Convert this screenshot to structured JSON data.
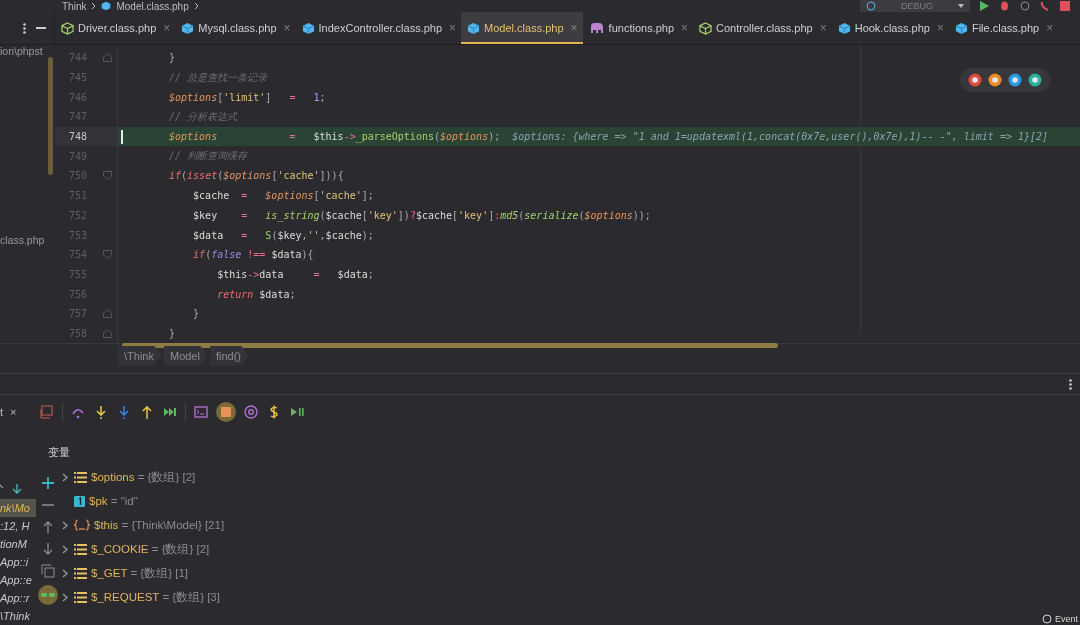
{
  "top_breadcrumbs": [
    "Think",
    "Model.class.php"
  ],
  "run_config": {
    "label": "DEBUG"
  },
  "tabs": [
    {
      "label": "Driver.class.php",
      "kind": "outline",
      "close": "×",
      "selected": false
    },
    {
      "label": "Mysql.class.php",
      "kind": "solid",
      "close": "×",
      "selected": false
    },
    {
      "label": "IndexController.class.php",
      "kind": "solid",
      "close": "×",
      "selected": false
    },
    {
      "label": "Model.class.php",
      "kind": "solid",
      "close": "×",
      "selected": true
    },
    {
      "label": "functions.php",
      "kind": "elephant",
      "close": "×",
      "selected": false
    },
    {
      "label": "Controller.class.php",
      "kind": "outline",
      "close": "×",
      "selected": false
    },
    {
      "label": "Hook.class.php",
      "kind": "solid",
      "close": "×",
      "selected": false
    },
    {
      "label": "File.class.php",
      "kind": "solid",
      "close": "×",
      "selected": false
    }
  ],
  "project_panel": {
    "items": [
      "ion\\phpst",
      "class.php"
    ]
  },
  "editor": {
    "lines": [
      {
        "number": "744",
        "current": false,
        "fold_end": true,
        "tokens": [
          {
            "kind": "punct",
            "text": "}"
          }
        ]
      },
      {
        "number": "745",
        "current": false,
        "tokens": [
          {
            "kind": "comment",
            "text": "// 总是查找一条记录"
          }
        ]
      },
      {
        "number": "746",
        "current": false,
        "tokens": [
          {
            "kind": "param",
            "text": "$options"
          },
          {
            "kind": "punct",
            "text": "["
          },
          {
            "kind": "str",
            "text": "'limit'"
          },
          {
            "kind": "punct",
            "text": "]"
          },
          {
            "kind": "op",
            "text": "   ="
          },
          {
            "kind": "num",
            "text": "   1"
          },
          {
            "kind": "punct",
            "text": ";"
          }
        ]
      },
      {
        "number": "747",
        "current": false,
        "tokens": [
          {
            "kind": "comment",
            "text": "// 分析表达式"
          }
        ]
      },
      {
        "number": "748",
        "current": true,
        "tokens": [
          {
            "kind": "param",
            "text": "$options"
          },
          {
            "kind": "op",
            "text": "            ="
          },
          {
            "kind": "var",
            "text": "   $this"
          },
          {
            "kind": "op",
            "text": "->"
          },
          {
            "kind": "method",
            "text": "_parseOptions"
          },
          {
            "kind": "punct",
            "text": "("
          },
          {
            "kind": "param",
            "text": "$options"
          },
          {
            "kind": "punct",
            "text": ");"
          },
          {
            "kind": "hint",
            "text": "  $options: {where => \"1 and 1=updatexml(1,concat(0x7e,user(),0x7e),1)-- -\", limit => 1}[2]"
          }
        ]
      },
      {
        "number": "749",
        "current": false,
        "tokens": [
          {
            "kind": "comment",
            "text": "// 判断查询缓存"
          }
        ]
      },
      {
        "number": "750",
        "current": false,
        "fold_start": true,
        "tokens": [
          {
            "kind": "kw",
            "text": "if"
          },
          {
            "kind": "punct",
            "text": "("
          },
          {
            "kind": "kw",
            "text": "isset"
          },
          {
            "kind": "punct",
            "text": "("
          },
          {
            "kind": "param",
            "text": "$options"
          },
          {
            "kind": "punct",
            "text": "["
          },
          {
            "kind": "str",
            "text": "'cache'"
          },
          {
            "kind": "punct",
            "text": "])){"
          }
        ]
      },
      {
        "number": "751",
        "current": false,
        "tokens": [
          {
            "kind": "var",
            "text": "    $cache"
          },
          {
            "kind": "op",
            "text": "  ="
          },
          {
            "kind": "param",
            "text": "   $options"
          },
          {
            "kind": "punct",
            "text": "["
          },
          {
            "kind": "str",
            "text": "'cache'"
          },
          {
            "kind": "punct",
            "text": "];"
          }
        ]
      },
      {
        "number": "752",
        "current": false,
        "tokens": [
          {
            "kind": "var",
            "text": "    $key"
          },
          {
            "kind": "op",
            "text": "    ="
          },
          {
            "kind": "fn",
            "text": "   is_string"
          },
          {
            "kind": "punct",
            "text": "("
          },
          {
            "kind": "var",
            "text": "$cache"
          },
          {
            "kind": "punct",
            "text": "["
          },
          {
            "kind": "str",
            "text": "'key'"
          },
          {
            "kind": "punct",
            "text": "])"
          },
          {
            "kind": "op",
            "text": "?"
          },
          {
            "kind": "var",
            "text": "$cache"
          },
          {
            "kind": "punct",
            "text": "["
          },
          {
            "kind": "str",
            "text": "'key'"
          },
          {
            "kind": "punct",
            "text": "]"
          },
          {
            "kind": "op",
            "text": ":"
          },
          {
            "kind": "fn",
            "text": "md5"
          },
          {
            "kind": "punct",
            "text": "("
          },
          {
            "kind": "fn",
            "text": "serialize"
          },
          {
            "kind": "punct",
            "text": "("
          },
          {
            "kind": "param",
            "text": "$options"
          },
          {
            "kind": "punct",
            "text": "));"
          }
        ]
      },
      {
        "number": "753",
        "current": false,
        "tokens": [
          {
            "kind": "var",
            "text": "    $data"
          },
          {
            "kind": "op",
            "text": "   ="
          },
          {
            "kind": "method",
            "text": "   S"
          },
          {
            "kind": "punct",
            "text": "("
          },
          {
            "kind": "var",
            "text": "$key"
          },
          {
            "kind": "punct",
            "text": ","
          },
          {
            "kind": "str",
            "text": "''"
          },
          {
            "kind": "punct",
            "text": ","
          },
          {
            "kind": "var",
            "text": "$cache"
          },
          {
            "kind": "punct",
            "text": ");"
          }
        ]
      },
      {
        "number": "754",
        "current": false,
        "fold_start": true,
        "tokens": [
          {
            "kind": "kw",
            "text": "    if"
          },
          {
            "kind": "punct",
            "text": "("
          },
          {
            "kind": "const",
            "text": "false"
          },
          {
            "kind": "op",
            "text": " !=="
          },
          {
            "kind": "var",
            "text": " $data"
          },
          {
            "kind": "punct",
            "text": "){"
          }
        ]
      },
      {
        "number": "755",
        "current": false,
        "tokens": [
          {
            "kind": "var",
            "text": "        $this"
          },
          {
            "kind": "op",
            "text": "->"
          },
          {
            "kind": "var",
            "text": "data"
          },
          {
            "kind": "op",
            "text": "     ="
          },
          {
            "kind": "var",
            "text": "   $data"
          },
          {
            "kind": "punct",
            "text": ";"
          }
        ]
      },
      {
        "number": "756",
        "current": false,
        "tokens": [
          {
            "kind": "kw",
            "text": "        return"
          },
          {
            "kind": "var",
            "text": " $data"
          },
          {
            "kind": "punct",
            "text": ";"
          }
        ]
      },
      {
        "number": "757",
        "current": false,
        "fold_end": true,
        "tokens": [
          {
            "kind": "punct",
            "text": "    }"
          }
        ]
      },
      {
        "number": "758",
        "current": false,
        "fold_end": true,
        "tokens": [
          {
            "kind": "punct",
            "text": "}"
          }
        ]
      }
    ]
  },
  "editor_breadcrumbs": [
    "\\Think",
    "Model",
    "find()"
  ],
  "debug": {
    "tab_label": "t",
    "tab_close": "×",
    "variables_title": "变量",
    "frames": [
      {
        "text": "nk\\Mo",
        "selected": true
      },
      {
        "text": ":12, H",
        "selected": false
      },
      {
        "text": "tionM",
        "selected": false
      },
      {
        "text": "App::i",
        "selected": false
      },
      {
        "text": "App::e",
        "selected": false
      },
      {
        "text": "App::r",
        "selected": false
      },
      {
        "text": "\\Think",
        "selected": false
      }
    ],
    "variables": [
      {
        "kind": "array",
        "name": "$options",
        "value": "= {数组} [2]",
        "expandable": true
      },
      {
        "kind": "scalar",
        "name": "$pk",
        "value": "= \"id\"",
        "expandable": false
      },
      {
        "kind": "object",
        "name": "$this",
        "value": "= {Think\\Model} [21]",
        "expandable": true
      },
      {
        "kind": "array",
        "name": "$_COOKIE",
        "value": "= {数组} [2]",
        "expandable": true
      },
      {
        "kind": "array",
        "name": "$_GET",
        "value": "= {数组} [1]",
        "expandable": true
      },
      {
        "kind": "array",
        "name": "$_REQUEST",
        "value": "= {数组} [3]",
        "expandable": true
      }
    ]
  },
  "status": {
    "label": "Event"
  }
}
